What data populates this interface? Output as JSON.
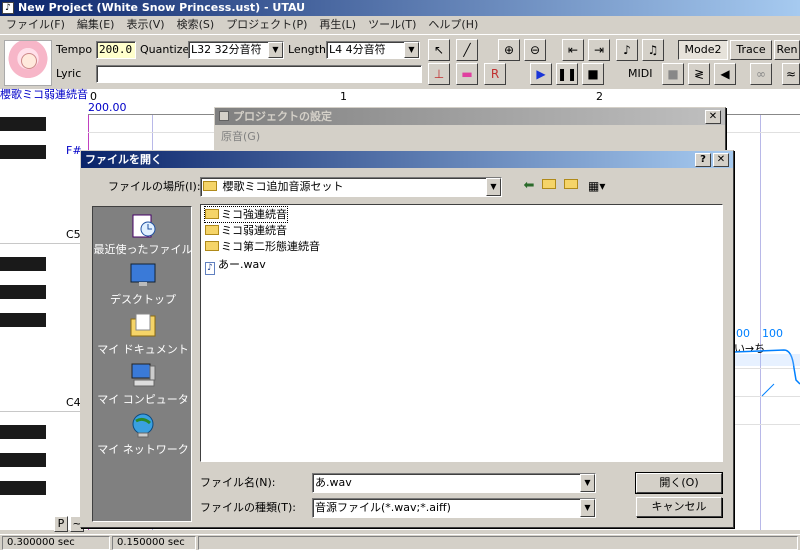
{
  "window": {
    "title": "New Project (White Snow Princess.ust) - UTAU"
  },
  "menu": [
    "ファイル(F)",
    "編集(E)",
    "表示(V)",
    "検索(S)",
    "プロジェクト(P)",
    "再生(L)",
    "ツール(T)",
    "ヘルプ(H)"
  ],
  "toolbar": {
    "tempo_label": "Tempo",
    "tempo_value": "200.0",
    "quantize_label": "Quantize",
    "quantize_value": "L32 32分音符",
    "length_label": "Length",
    "length_value": "L4  4分音符",
    "lyric_label": "Lyric",
    "lyric_value": "",
    "mode2_label": "Mode2",
    "trace_label": "Trace",
    "ren_label": "Ren",
    "midi_label": "MIDI"
  },
  "editor": {
    "voicebank_header": "櫻歌ミコ弱連続音",
    "ruler_tempo": "200.00",
    "ruler_marks": [
      "0",
      "1",
      "2"
    ],
    "key_labels": [
      "F#",
      "C5",
      "C4"
    ],
    "lyric_note": "い→ち",
    "note_numbers": [
      "00",
      "100"
    ],
    "track_buttons": [
      "P",
      "~"
    ]
  },
  "project_dialog": {
    "title": "プロジェクトの設定",
    "first_label": "原音(G)"
  },
  "open_dialog": {
    "title": "ファイルを開く",
    "look_in_label": "ファイルの場所(I):",
    "look_in_value": "櫻歌ミコ追加音源セット",
    "places": [
      "最近使ったファイル",
      "デスクトップ",
      "マイ ドキュメント",
      "マイ コンピュータ",
      "マイ ネットワーク"
    ],
    "files": [
      {
        "name": "ミコ強連続音",
        "type": "folder"
      },
      {
        "name": "ミコ弱連続音",
        "type": "folder"
      },
      {
        "name": "ミコ第二形態連続音",
        "type": "folder"
      },
      {
        "name": "あー.wav",
        "type": "wav"
      }
    ],
    "filename_label": "ファイル名(N):",
    "filename_value": "あ.wav",
    "filetype_label": "ファイルの種類(T):",
    "filetype_value": "音源ファイル(*.wav;*.aiff)",
    "open_button": "開く(O)",
    "cancel_button": "キャンセル"
  },
  "status": {
    "cell1": "0.300000 sec",
    "cell2": "0.150000 sec"
  },
  "colors": {
    "title_active": "#0a246a",
    "grid_line": "#b8b8e8",
    "note_line": "#0080ff",
    "header_text": "#0000c8"
  }
}
